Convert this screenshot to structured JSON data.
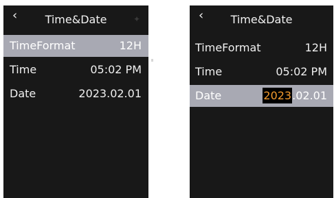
{
  "panels": [
    {
      "title": "Time&Date",
      "back_icon": "‹",
      "rows": [
        {
          "label": "TimeFormat",
          "value": "12H",
          "selected": true
        },
        {
          "label": "Time",
          "value": "05:02 PM",
          "selected": false
        },
        {
          "label": "Date",
          "value": "2023.02.01",
          "selected": false
        }
      ]
    },
    {
      "title": "Time&Date",
      "back_icon": "‹",
      "rows": [
        {
          "label": "TimeFormat",
          "value": "12H",
          "selected": false
        },
        {
          "label": "Time",
          "value": "05:02 PM",
          "selected": false
        },
        {
          "label": "Date",
          "value_editing": "2023",
          "value_rest": ".02.01",
          "selected": true
        }
      ]
    }
  ],
  "colors": {
    "screen_bg": "#181818",
    "selected_bg": "#a8a9b3",
    "edit_highlight": "#f39a2d"
  }
}
